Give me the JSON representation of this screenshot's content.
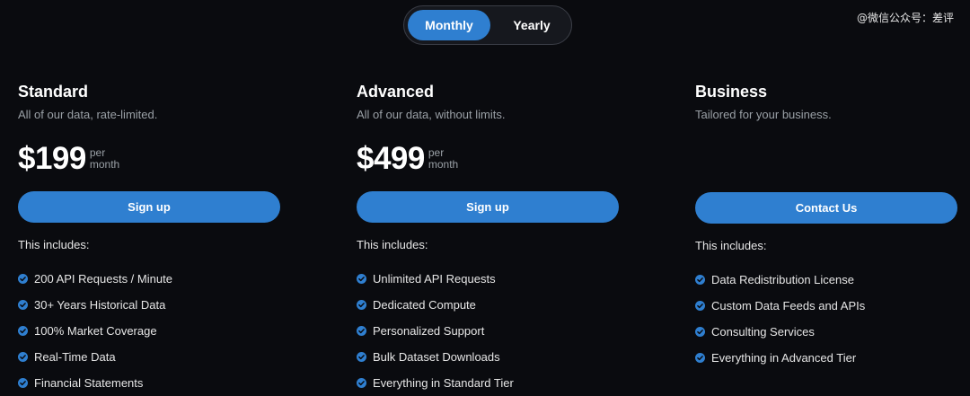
{
  "billing_toggle": {
    "monthly_label": "Monthly",
    "yearly_label": "Yearly",
    "selected": "Monthly"
  },
  "watermark": "@微信公众号：差评",
  "plans": [
    {
      "name": "Standard",
      "description": "All of our data, rate-limited.",
      "price": "$199",
      "period_top": "per",
      "period_bottom": "month",
      "cta": "Sign up",
      "includes_label": "This includes:",
      "features": [
        "200 API Requests / Minute",
        "30+ Years Historical Data",
        "100% Market Coverage",
        "Real-Time Data",
        "Financial Statements"
      ]
    },
    {
      "name": "Advanced",
      "description": "All of our data, without limits.",
      "price": "$499",
      "period_top": "per",
      "period_bottom": "month",
      "cta": "Sign up",
      "includes_label": "This includes:",
      "features": [
        "Unlimited API Requests",
        "Dedicated Compute",
        "Personalized Support",
        "Bulk Dataset Downloads",
        "Everything in Standard Tier"
      ]
    },
    {
      "name": "Business",
      "description": "Tailored for your business.",
      "cta": "Contact Us",
      "includes_label": "This includes:",
      "features": [
        "Data Redistribution License",
        "Custom Data Feeds and APIs",
        "Consulting Services",
        "Everything in Advanced Tier"
      ]
    }
  ],
  "icons": {
    "feature_bullet": "check-circle-icon"
  },
  "colors": {
    "accent": "#2f7fd0",
    "background": "#0a0b0f",
    "muted_text": "#9aa0a6"
  }
}
